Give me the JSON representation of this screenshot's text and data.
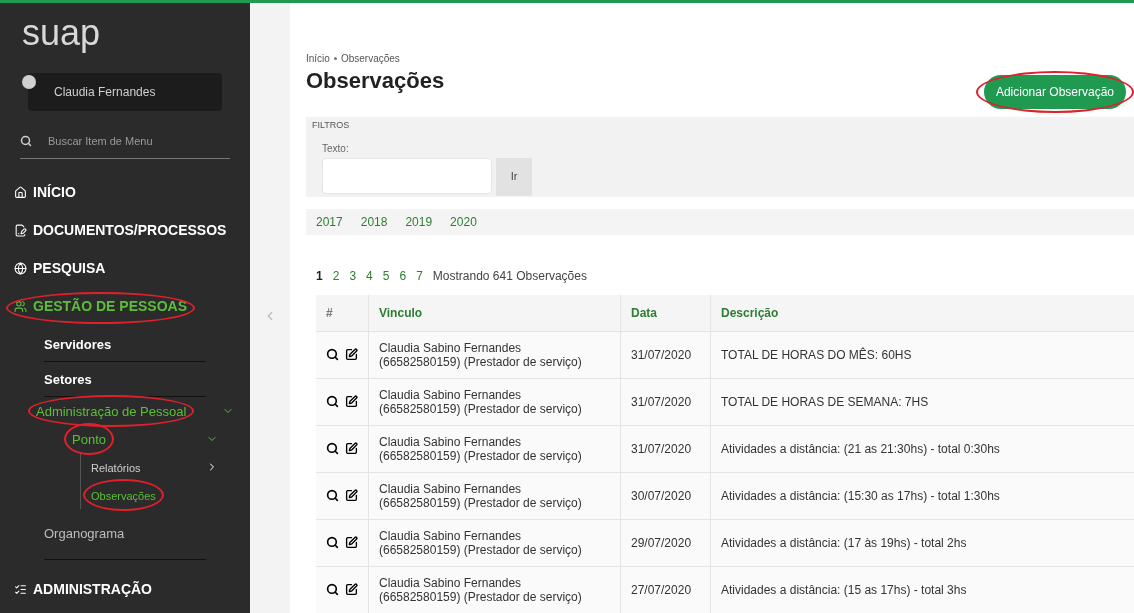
{
  "sidebar": {
    "logo": "suap",
    "user": {
      "name": "Claudia Fernandes"
    },
    "search": {
      "placeholder": "Buscar Item de Menu"
    },
    "menu": [
      {
        "label": "INÍCIO",
        "active": false,
        "annotated": false
      },
      {
        "label": "DOCUMENTOS/PROCESSOS",
        "active": false,
        "annotated": false
      },
      {
        "label": "PESQUISA",
        "active": false,
        "annotated": false
      },
      {
        "label": "GESTÃO DE PESSOAS",
        "active": true,
        "annotated": true,
        "children": [
          {
            "label": "Servidores",
            "kind": "link",
            "annotated": false
          },
          {
            "label": "Setores",
            "kind": "link",
            "annotated": false
          },
          {
            "label": "Administração de Pessoal",
            "kind": "group",
            "expanded": true,
            "annotated": true,
            "children": [
              {
                "label": "Ponto",
                "kind": "group",
                "expanded": true,
                "annotated": true,
                "children": [
                  {
                    "label": "Relatórios",
                    "selected": false,
                    "annotated": false,
                    "has_submenu": true
                  },
                  {
                    "label": "Observações",
                    "selected": true,
                    "annotated": true,
                    "has_submenu": false
                  }
                ]
              }
            ]
          },
          {
            "label": "Organograma",
            "kind": "plain",
            "annotated": false
          }
        ]
      },
      {
        "label": "ADMINISTRAÇÃO",
        "active": false,
        "annotated": false
      }
    ]
  },
  "breadcrumb": [
    "Início",
    "Observações"
  ],
  "title": "Observações",
  "add_button": {
    "label": "Adicionar Observação",
    "annotated": true
  },
  "filters": {
    "legend": "FILTROS",
    "field_label": "Texto:",
    "submit": "Ir"
  },
  "years": [
    "2017",
    "2018",
    "2019",
    "2020"
  ],
  "pagination": {
    "pages": [
      {
        "label": "1",
        "selected": true
      },
      {
        "label": "2",
        "selected": false
      },
      {
        "label": "3",
        "selected": false
      },
      {
        "label": "4",
        "selected": false
      },
      {
        "label": "5",
        "selected": false
      },
      {
        "label": "6",
        "selected": false
      },
      {
        "label": "7",
        "selected": false
      }
    ],
    "summary": "Mostrando 641 Observações"
  },
  "table": {
    "columns": [
      "#",
      "Vinculo",
      "Data",
      "Descrição"
    ],
    "rows": [
      {
        "vinculo": "Claudia Sabino Fernandes\n(66582580159) (Prestador de serviço)",
        "data": "31/07/2020",
        "descricao": "TOTAL DE HORAS DO MÊS: 60HS"
      },
      {
        "vinculo": "Claudia Sabino Fernandes\n(66582580159) (Prestador de serviço)",
        "data": "31/07/2020",
        "descricao": "TOTAL DE HORAS DE SEMANA: 7HS"
      },
      {
        "vinculo": "Claudia Sabino Fernandes\n(66582580159) (Prestador de serviço)",
        "data": "31/07/2020",
        "descricao": "Atividades a distância: (21 as 21:30hs) - total 0:30hs"
      },
      {
        "vinculo": "Claudia Sabino Fernandes\n(66582580159) (Prestador de serviço)",
        "data": "30/07/2020",
        "descricao": "Atividades a distância: (15:30 as 17hs) - total 1:30hs"
      },
      {
        "vinculo": "Claudia Sabino Fernandes\n(66582580159) (Prestador de serviço)",
        "data": "29/07/2020",
        "descricao": "Atividades a distância: (17 às 19hs) - total 2hs"
      },
      {
        "vinculo": "Claudia Sabino Fernandes\n(66582580159) (Prestador de serviço)",
        "data": "27/07/2020",
        "descricao": "Atividades a distância: (15 as 17hs) - total 3hs"
      }
    ]
  }
}
